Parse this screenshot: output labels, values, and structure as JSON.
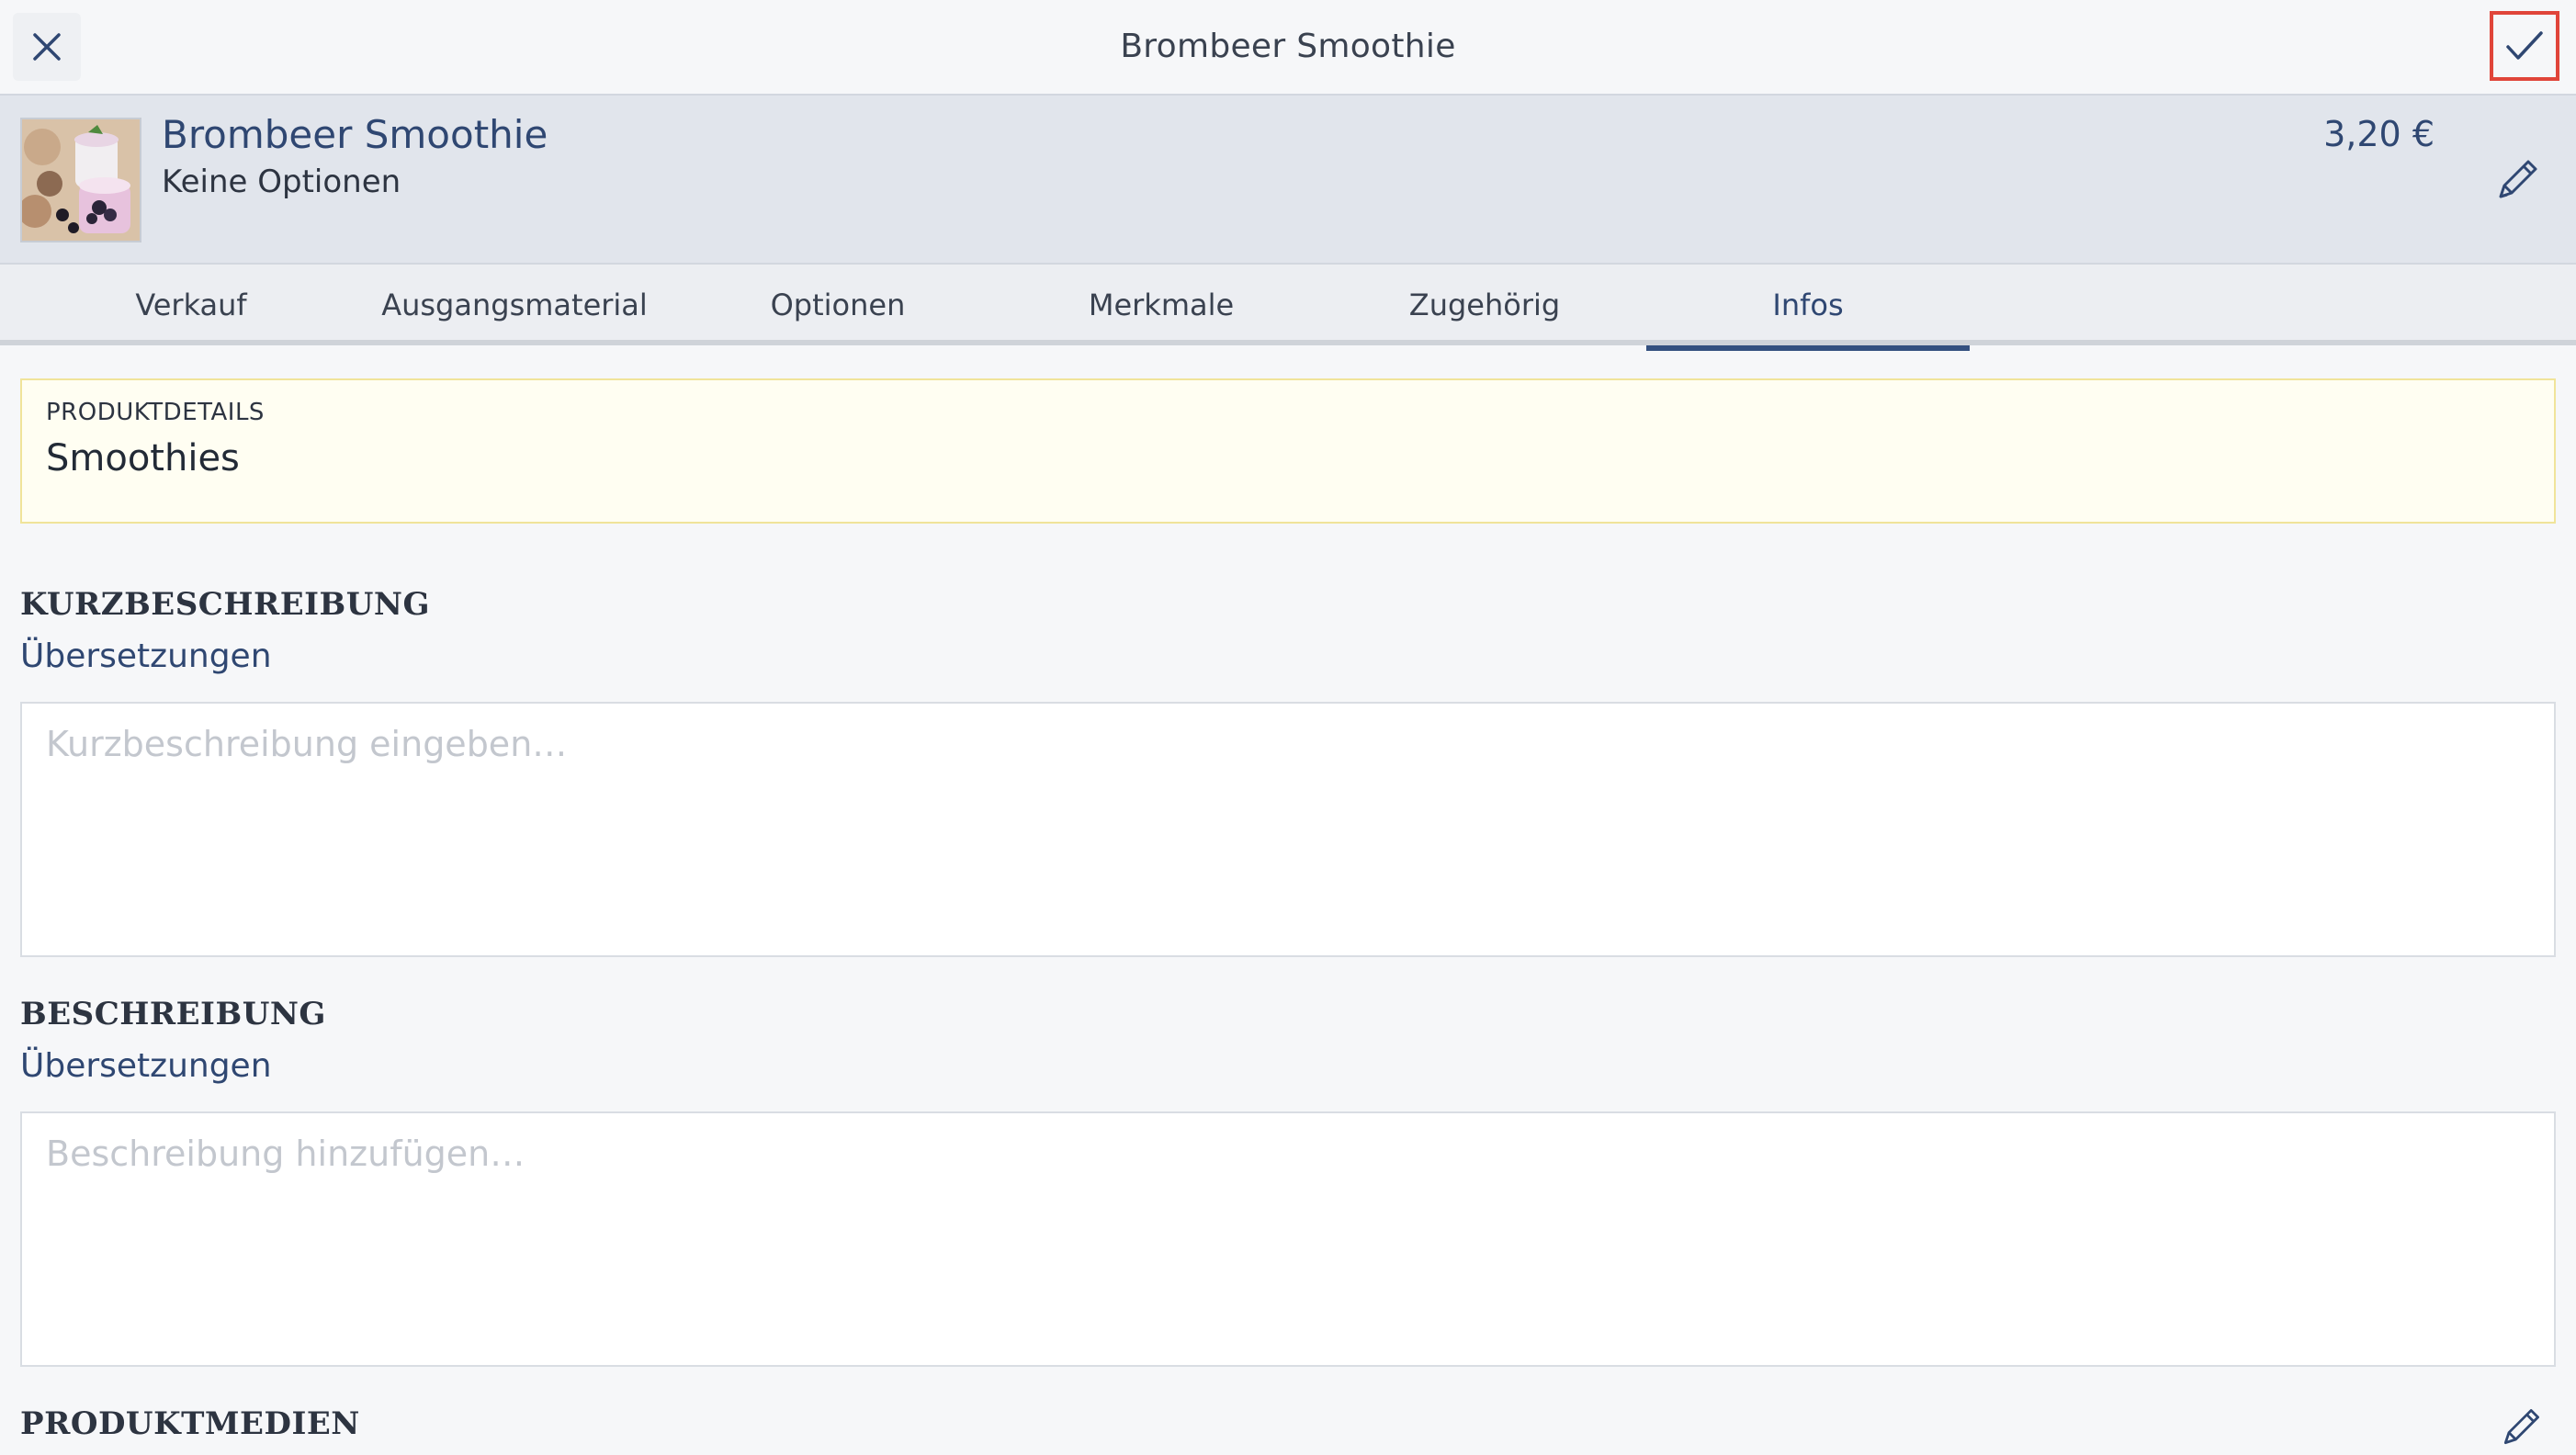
{
  "window": {
    "title": "Brombeer Smoothie"
  },
  "header": {
    "close_icon": "close-icon",
    "confirm_icon": "checkmark-icon"
  },
  "product": {
    "name": "Brombeer Smoothie",
    "options": "Keine Optionen",
    "price": "3,20 €",
    "thumbnail_alt": "smoothie-photo",
    "edit_icon": "pencil-icon"
  },
  "tabs": [
    {
      "label": "Verkauf",
      "active": false
    },
    {
      "label": "Ausgangsmaterial",
      "active": false
    },
    {
      "label": "Optionen",
      "active": false
    },
    {
      "label": "Merkmale",
      "active": false
    },
    {
      "label": "Zugehörig",
      "active": false
    },
    {
      "label": "Infos",
      "active": true
    }
  ],
  "details": {
    "label": "PRODUKTDETAILS",
    "value": "Smoothies"
  },
  "short_description": {
    "title": "KURZBESCHREIBUNG",
    "link": "Übersetzungen",
    "placeholder": "Kurzbeschreibung eingeben…",
    "value": ""
  },
  "description": {
    "title": "BESCHREIBUNG",
    "link": "Übersetzungen",
    "placeholder": "Beschreibung hinzufügen…",
    "value": ""
  },
  "media": {
    "title": "PRODUKTMEDIEN",
    "edit_icon": "pencil-icon"
  },
  "colors": {
    "accent": "#2f4772",
    "active_tab_underline": "#34507f",
    "confirm_highlight": "#e0453a",
    "details_background": "#fffef2"
  }
}
